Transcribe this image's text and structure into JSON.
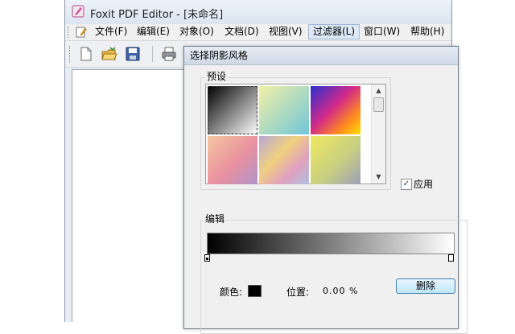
{
  "window": {
    "title": "Foxit PDF Editor - [未命名]"
  },
  "menu": {
    "items": [
      "文件(F)",
      "编辑(E)",
      "对象(O)",
      "文档(D)",
      "视图(V)",
      "过滤器(L)",
      "窗口(W)",
      "帮助(H)"
    ],
    "active": "过滤器(L)"
  },
  "toolbar": {
    "icons": [
      "new-document-icon",
      "open-folder-icon",
      "save-disk-icon",
      "print-icon"
    ]
  },
  "dialog": {
    "title": "选择阴影风格",
    "preset_group": "预设",
    "apply_label": "应用",
    "apply_checked": true,
    "edit_group": "编辑",
    "color_label": "颜色:",
    "color_value": "#000000",
    "position_label": "位置:",
    "position_value": "0.00 %",
    "delete_label": "删除"
  },
  "presets": [
    {
      "name": "black-white",
      "colors": [
        "#000000",
        "#ffffff"
      ]
    },
    {
      "name": "yellow-cyan",
      "colors": [
        "#f3f0a6",
        "#6fc6d8"
      ]
    },
    {
      "name": "rainbow",
      "colors": [
        "#2a2fd0",
        "#e02060",
        "#ffe000"
      ]
    },
    {
      "name": "pink-purple",
      "colors": [
        "#f6c7a0",
        "#e8909f",
        "#b095c8"
      ]
    },
    {
      "name": "pastel-stripe",
      "colors": [
        "#b9a8d4",
        "#f0d080",
        "#e0a0c0"
      ]
    },
    {
      "name": "yellow-blue",
      "colors": [
        "#f0e860",
        "#9ea0b6"
      ]
    }
  ],
  "gradient": {
    "start": "#000000",
    "end": "#ffffff"
  }
}
